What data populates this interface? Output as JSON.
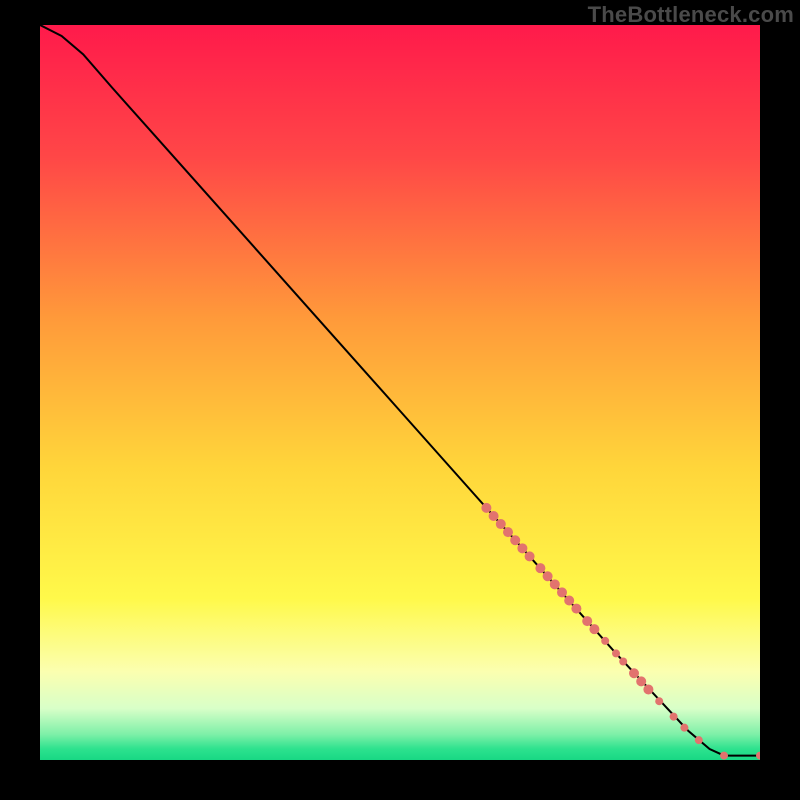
{
  "watermark": "TheBottleneck.com",
  "chart_data": {
    "type": "line",
    "title": "",
    "xlabel": "",
    "ylabel": "",
    "xlim": [
      0,
      100
    ],
    "ylim": [
      0,
      100
    ],
    "curve": [
      {
        "x": 0,
        "y": 100
      },
      {
        "x": 3,
        "y": 98.5
      },
      {
        "x": 6,
        "y": 96
      },
      {
        "x": 10,
        "y": 91.5
      },
      {
        "x": 20,
        "y": 80.5
      },
      {
        "x": 30,
        "y": 69.5
      },
      {
        "x": 40,
        "y": 58.5
      },
      {
        "x": 50,
        "y": 47.5
      },
      {
        "x": 60,
        "y": 36.5
      },
      {
        "x": 70,
        "y": 25.5
      },
      {
        "x": 80,
        "y": 14.5
      },
      {
        "x": 90,
        "y": 4.0
      },
      {
        "x": 93,
        "y": 1.5
      },
      {
        "x": 95,
        "y": 0.6
      },
      {
        "x": 100,
        "y": 0.6
      }
    ],
    "markers": [
      {
        "x": 62,
        "y": 34.3,
        "r": 5
      },
      {
        "x": 63,
        "y": 33.2,
        "r": 5
      },
      {
        "x": 64,
        "y": 32.1,
        "r": 5
      },
      {
        "x": 65,
        "y": 31.0,
        "r": 5
      },
      {
        "x": 66,
        "y": 29.9,
        "r": 5
      },
      {
        "x": 67,
        "y": 28.8,
        "r": 5
      },
      {
        "x": 68,
        "y": 27.7,
        "r": 5
      },
      {
        "x": 69.5,
        "y": 26.1,
        "r": 5
      },
      {
        "x": 70.5,
        "y": 25.0,
        "r": 5
      },
      {
        "x": 71.5,
        "y": 23.9,
        "r": 5
      },
      {
        "x": 72.5,
        "y": 22.8,
        "r": 5
      },
      {
        "x": 73.5,
        "y": 21.7,
        "r": 5
      },
      {
        "x": 74.5,
        "y": 20.6,
        "r": 5
      },
      {
        "x": 76,
        "y": 18.9,
        "r": 5
      },
      {
        "x": 77,
        "y": 17.8,
        "r": 5
      },
      {
        "x": 78.5,
        "y": 16.2,
        "r": 4
      },
      {
        "x": 80,
        "y": 14.5,
        "r": 4
      },
      {
        "x": 81,
        "y": 13.4,
        "r": 4
      },
      {
        "x": 82.5,
        "y": 11.8,
        "r": 5
      },
      {
        "x": 83.5,
        "y": 10.7,
        "r": 5
      },
      {
        "x": 84.5,
        "y": 9.6,
        "r": 5
      },
      {
        "x": 86,
        "y": 8.0,
        "r": 4
      },
      {
        "x": 88,
        "y": 5.9,
        "r": 4
      },
      {
        "x": 89.5,
        "y": 4.4,
        "r": 4
      },
      {
        "x": 91.5,
        "y": 2.7,
        "r": 4
      },
      {
        "x": 95,
        "y": 0.6,
        "r": 4
      },
      {
        "x": 100,
        "y": 0.6,
        "r": 4
      }
    ],
    "gradient_stops": [
      {
        "offset": 0,
        "color": "#ff1a4b"
      },
      {
        "offset": 0.18,
        "color": "#ff4747"
      },
      {
        "offset": 0.4,
        "color": "#ff9a3a"
      },
      {
        "offset": 0.6,
        "color": "#ffd53a"
      },
      {
        "offset": 0.78,
        "color": "#fff94a"
      },
      {
        "offset": 0.88,
        "color": "#fbffb0"
      },
      {
        "offset": 0.93,
        "color": "#d8ffc8"
      },
      {
        "offset": 0.965,
        "color": "#7ef0a8"
      },
      {
        "offset": 0.985,
        "color": "#2de28e"
      },
      {
        "offset": 1.0,
        "color": "#18d884"
      }
    ],
    "marker_color": "#e2736e",
    "line_color": "#000000"
  }
}
